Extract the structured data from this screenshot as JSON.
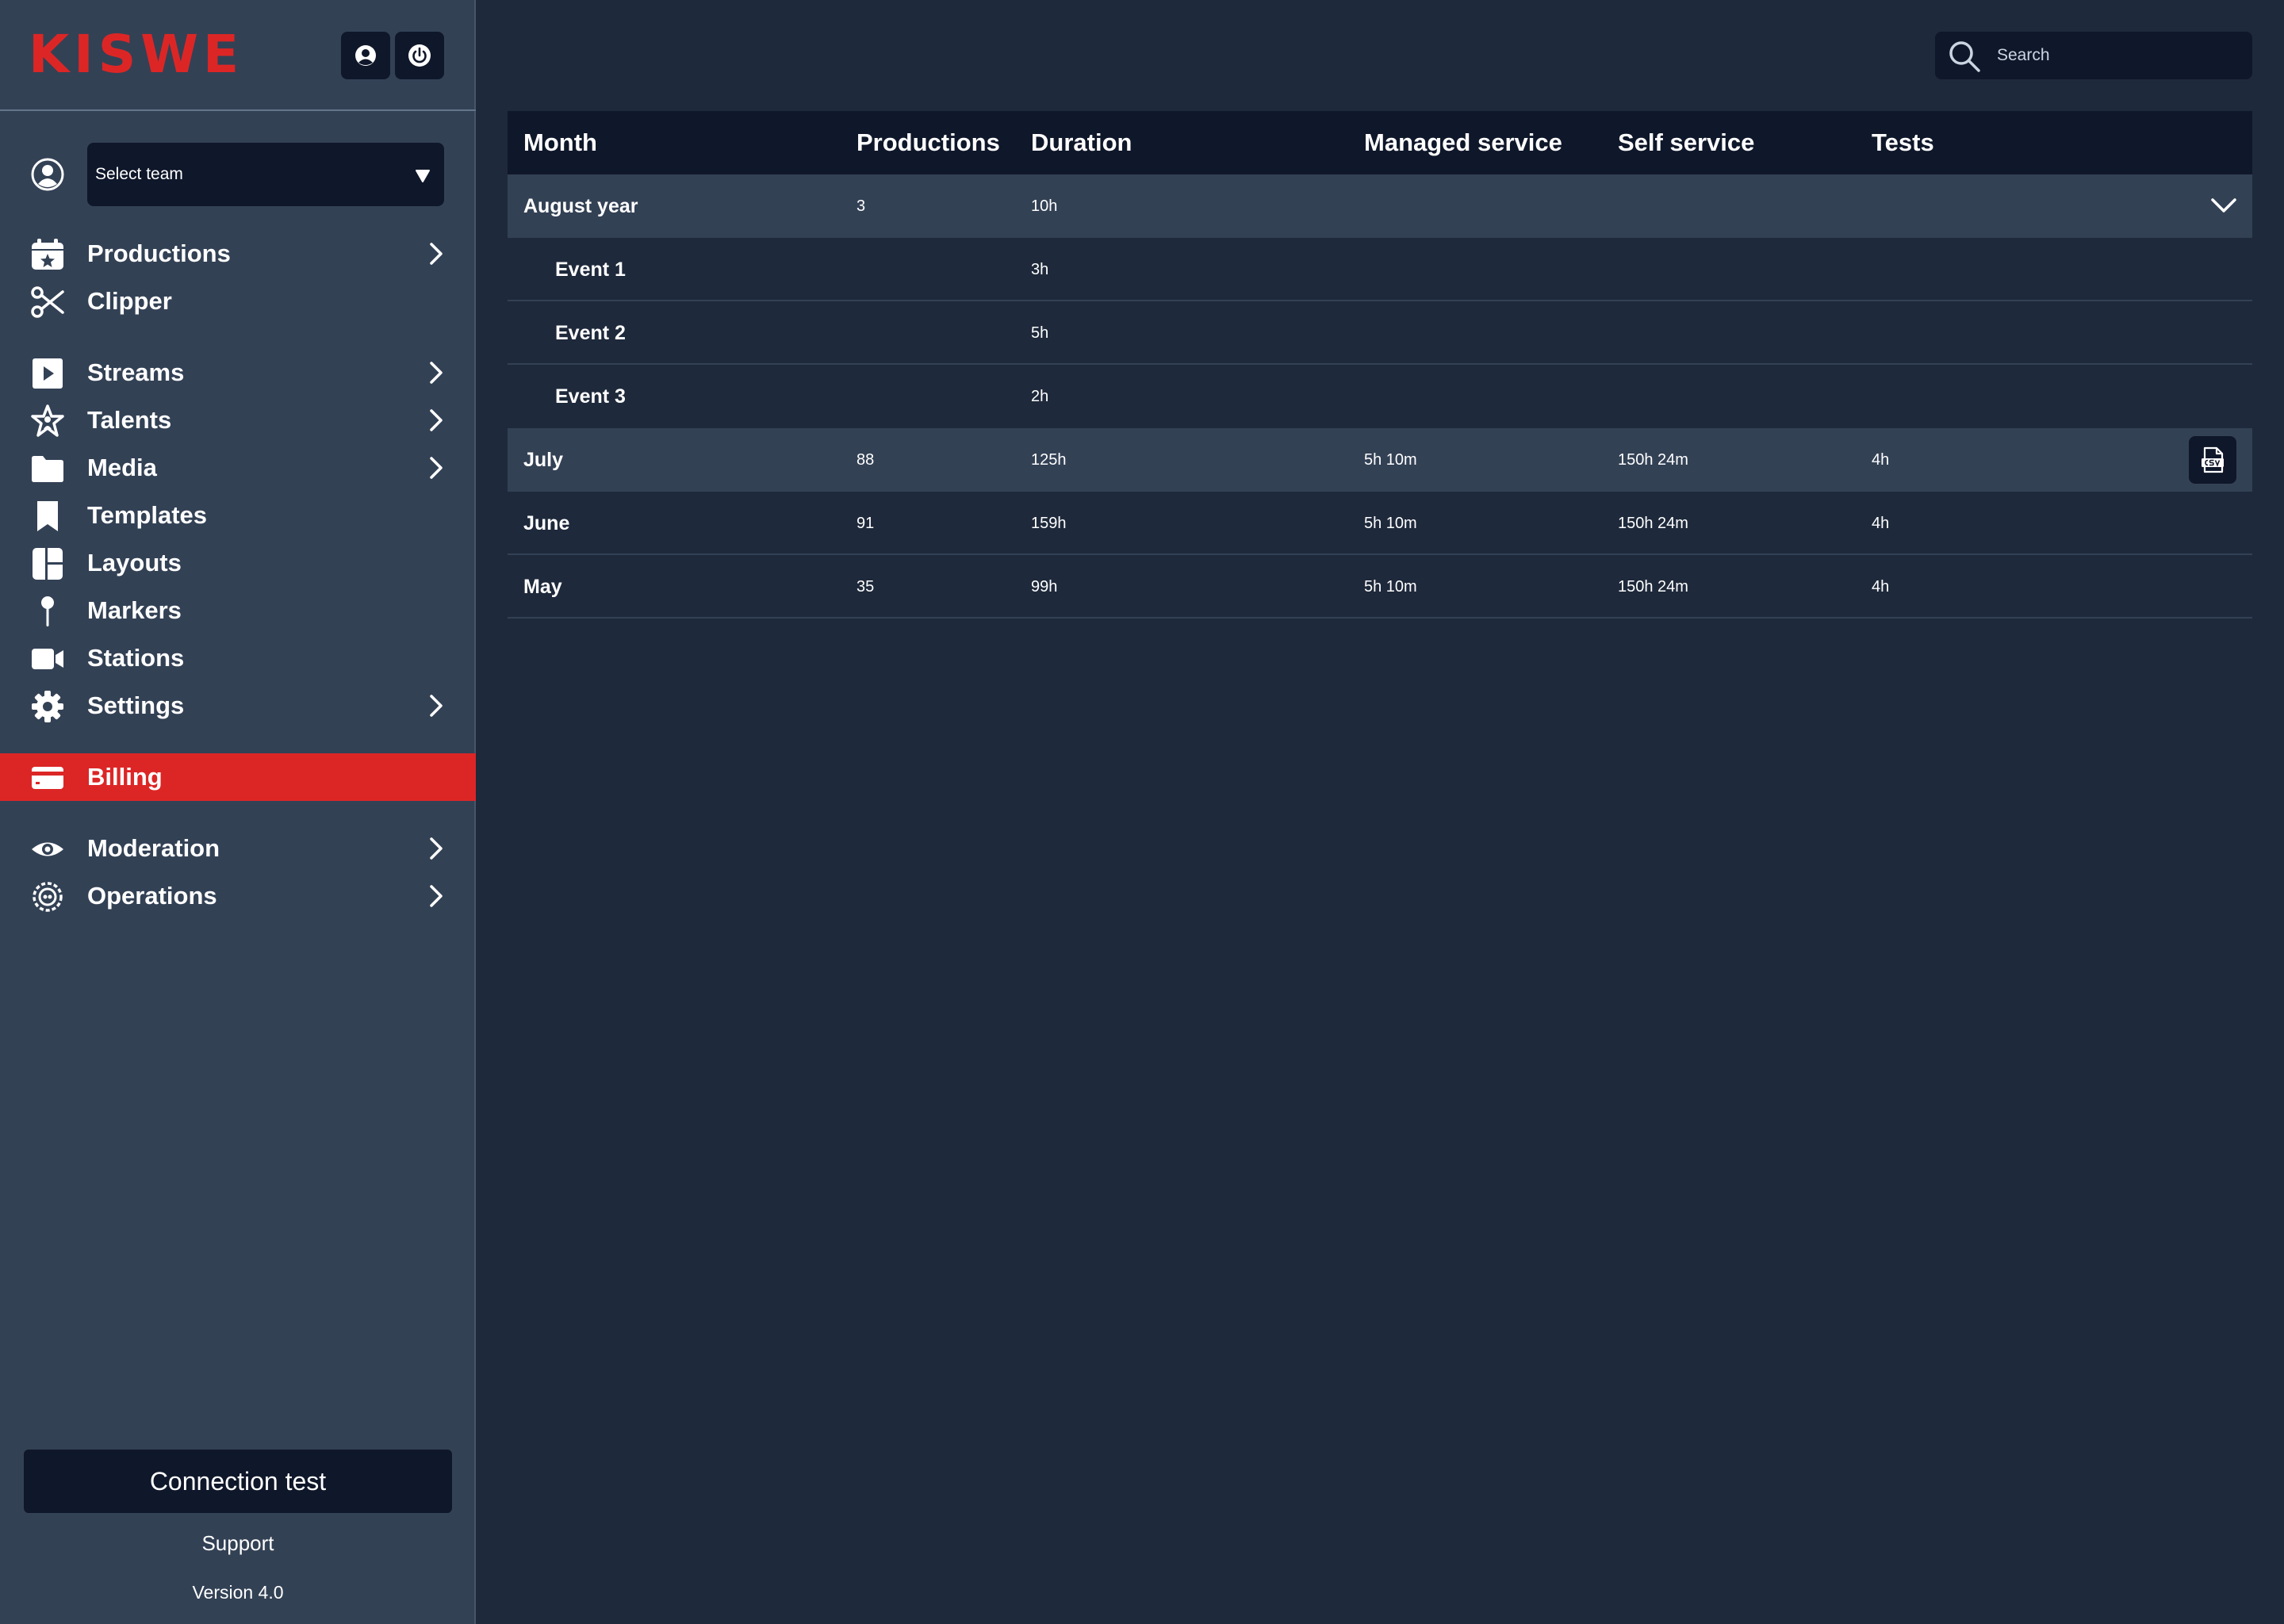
{
  "brand": {
    "logo_text": "KISWE",
    "accent_color": "#dc2626"
  },
  "header": {
    "profile_icon": "user-circle-icon",
    "power_icon": "power-icon"
  },
  "team_select": {
    "value": "Select team"
  },
  "nav": {
    "productions": "Productions",
    "clipper": "Clipper",
    "streams": "Streams",
    "talents": "Talents",
    "media": "Media",
    "templates": "Templates",
    "layouts": "Layouts",
    "markers": "Markers",
    "stations": "Stations",
    "settings": "Settings",
    "billing": "Billing",
    "moderation": "Moderation",
    "operations": "Operations"
  },
  "footer": {
    "connection_test": "Connection test",
    "support": "Support",
    "version": "Version 4.0"
  },
  "search": {
    "placeholder": "Search"
  },
  "table": {
    "columns": [
      "Month",
      "Productions",
      "Duration",
      "Managed service",
      "Self service",
      "Tests"
    ],
    "rows": [
      {
        "month": "August year",
        "productions": "3",
        "duration": "10h",
        "managed": "",
        "self": "",
        "tests": ""
      },
      {
        "month": "Event 1",
        "productions": "",
        "duration": "3h",
        "managed": "",
        "self": "",
        "tests": ""
      },
      {
        "month": "Event 2",
        "productions": "",
        "duration": "5h",
        "managed": "",
        "self": "",
        "tests": ""
      },
      {
        "month": "Event 3",
        "productions": "",
        "duration": "2h",
        "managed": "",
        "self": "",
        "tests": ""
      },
      {
        "month": "July",
        "productions": "88",
        "duration": "125h",
        "managed": "5h 10m",
        "self": "150h 24m",
        "tests": "4h"
      },
      {
        "month": "June",
        "productions": "91",
        "duration": "159h",
        "managed": "5h 10m",
        "self": "150h 24m",
        "tests": "4h"
      },
      {
        "month": "May",
        "productions": "35",
        "duration": "99h",
        "managed": "5h 10m",
        "self": "150h 24m",
        "tests": "4h"
      }
    ]
  },
  "colors": {
    "background": "#1e293b",
    "sidebar": "#334155",
    "panel_dark": "#0f172a",
    "active": "#dc2626"
  }
}
